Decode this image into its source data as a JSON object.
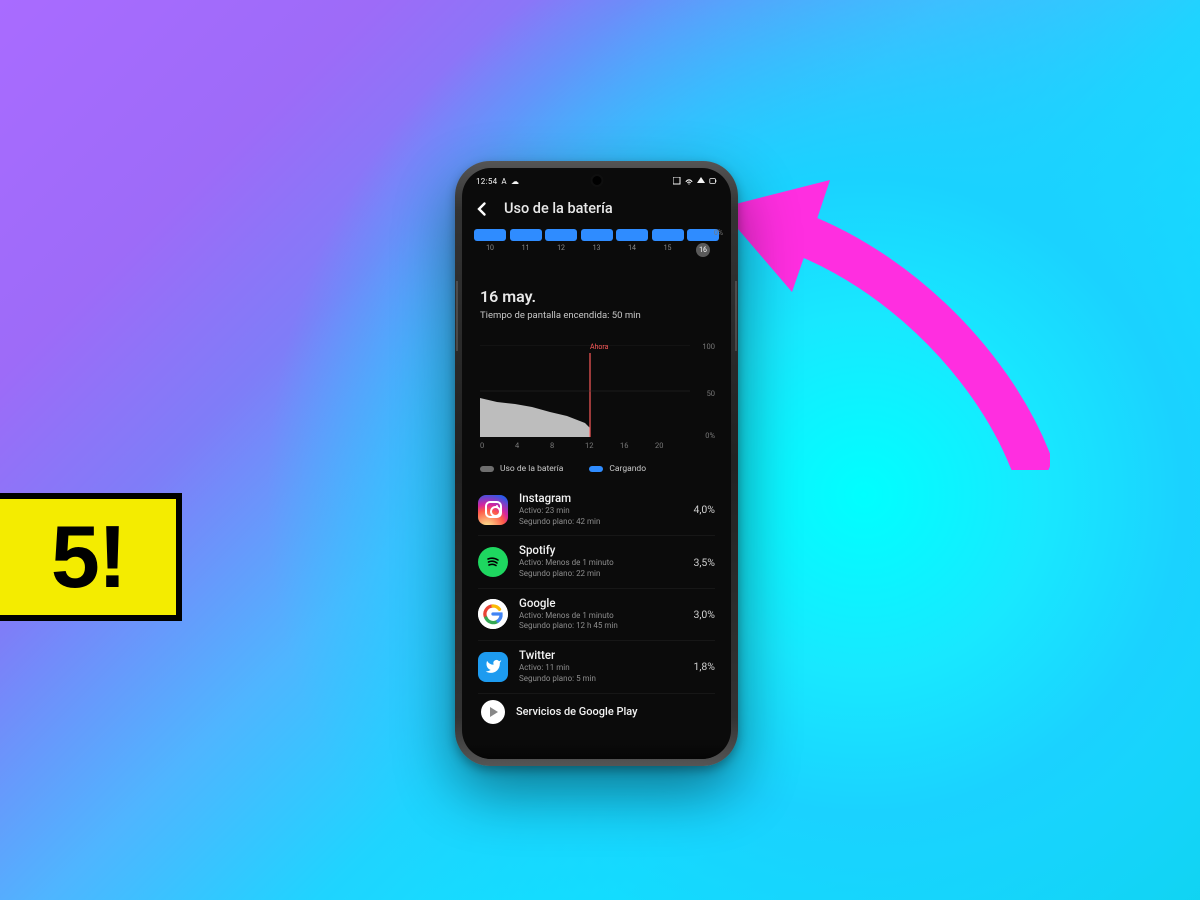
{
  "badge": {
    "text": "5!"
  },
  "statusbar": {
    "time": "12:54",
    "left_icons": [
      "A",
      "☁"
    ],
    "right_text": "📶📶🔋"
  },
  "header": {
    "title": "Uso de la batería"
  },
  "days": {
    "labels": [
      "10",
      "11",
      "12",
      "13",
      "14",
      "15",
      "16"
    ],
    "selected": "16",
    "zero_pct": "0%"
  },
  "detail": {
    "date": "16 may.",
    "screen_on_prefix": "Tiempo de pantalla encendida: ",
    "screen_on_value": "50 min"
  },
  "chart_data": {
    "type": "area",
    "title": "",
    "xlabel": "",
    "ylabel": "",
    "x_ticks": [
      "0",
      "4",
      "8",
      "12",
      "16",
      "20"
    ],
    "y_ticks": [
      "0%",
      "50",
      "100"
    ],
    "ylim": [
      0,
      100
    ],
    "now_label": "Ahora",
    "now_x": 12.5,
    "series": [
      {
        "name": "Uso de la batería",
        "x": [
          0,
          2,
          4,
          6,
          8,
          10,
          12,
          12.5
        ],
        "values": [
          42,
          38,
          35,
          32,
          27,
          22,
          15,
          10
        ]
      }
    ]
  },
  "legend": {
    "battery": "Uso de la batería",
    "charging": "Cargando"
  },
  "apps": [
    {
      "id": "instagram",
      "name": "Instagram",
      "active_line": "Activo: 23 min",
      "bg_line": "Segundo plano: 42 min",
      "pct": "4,0%"
    },
    {
      "id": "spotify",
      "name": "Spotify",
      "active_line": "Activo: Menos de 1 minuto",
      "bg_line": "Segundo plano: 22 min",
      "pct": "3,5%"
    },
    {
      "id": "google",
      "name": "Google",
      "active_line": "Activo: Menos de 1 minuto",
      "bg_line": "Segundo plano: 12 h 45 min",
      "pct": "3,0%"
    },
    {
      "id": "twitter",
      "name": "Twitter",
      "active_line": "Activo: 11 min",
      "bg_line": "Segundo plano: 5 min",
      "pct": "1,8%"
    }
  ],
  "last_app": {
    "id": "play",
    "name": "Servicios de Google Play"
  }
}
